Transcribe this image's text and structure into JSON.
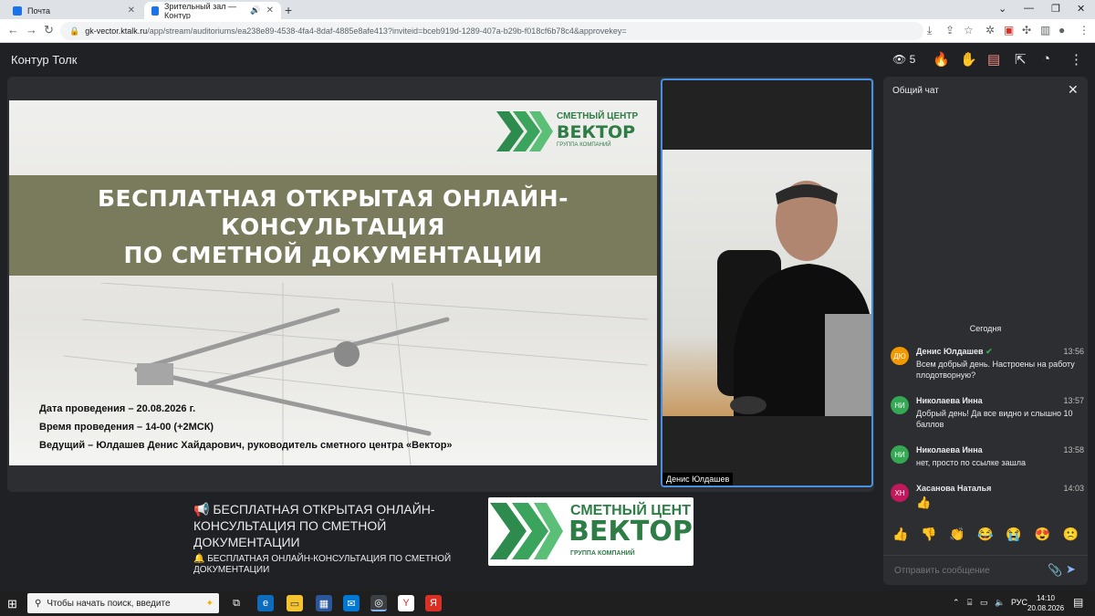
{
  "browser": {
    "tabs": [
      {
        "title": "Почта",
        "favicon_color": "#1a73e8"
      },
      {
        "title": "Зрительный зал — Контур",
        "favicon_color": "#1a73e8"
      }
    ],
    "url_host": "gk-vector.ktalk.ru",
    "url_path": "/app/stream/auditoriums/ea238e89-4538-4fa4-8daf-4885e8afe413?inviteid=bceb919d-1289-407a-b29b-f018cf6b78c4&approvekey="
  },
  "app": {
    "name": "Контур Толк",
    "viewers_count": "5"
  },
  "slide": {
    "title_lines": [
      "БЕСПЛАТНАЯ ОТКРЫТАЯ ОНЛАЙН-",
      "КОНСУЛЬТАЦИЯ",
      "ПО СМЕТНОЙ ДОКУМЕНТАЦИИ"
    ],
    "logo_line1": "СМЕТНЫЙ ЦЕНТР",
    "logo_line2": "ВЕКТОР",
    "logo_line3": "ГРУППА КОМПАНИЙ",
    "date_line": "Дата проведения – 20.08.2026 г.",
    "time_line": "Время проведения – 14-00 (+2МСК)",
    "host_line": "Ведущий – Юлдашев Денис Хайдарович, руководитель сметного центра «Вектор»"
  },
  "camera": {
    "participant_name": "Денис Юлдашев"
  },
  "announcement": {
    "title": "БЕСПЛАТНАЯ ОТКРЫТАЯ ОНЛАЙН-КОНСУЛЬТАЦИЯ ПО СМЕТНОЙ ДОКУМЕНТАЦИИ",
    "subtitle": "БЕСПЛАТНАЯ ОНЛАЙН-КОНСУЛЬТАЦИЯ ПО СМЕТНОЙ ДОКУМЕНТАЦИИ",
    "logo_line1": "СМЕТНЫЙ ЦЕНТ",
    "logo_line2": "ВЕКТОР",
    "logo_line3": "ГРУППА КОМПАНИЙ"
  },
  "chat": {
    "title": "Общий чат",
    "date_divider": "Сегодня",
    "messages": [
      {
        "initials": "ДЮ",
        "author": "Денис Юлдашев",
        "time": "13:56",
        "text": "Всем добрый день. Настроены на работу плодотворную?",
        "avatar_color": "#f29900"
      },
      {
        "initials": "НИ",
        "author": "Николаева Инна",
        "time": "13:57",
        "text": "Добрый день! Да все видно и слышно 10 баллов",
        "avatar_color": "#34a853"
      },
      {
        "initials": "НИ",
        "author": "Николаева Инна",
        "time": "13:58",
        "text": "нет, просто по ссылке зашла",
        "avatar_color": "#34a853"
      },
      {
        "initials": "ХН",
        "author": "Хасанова Наталья",
        "time": "14:03",
        "text": "👍",
        "avatar_color": "#c2185b"
      }
    ],
    "reactions": [
      "👍",
      "👎",
      "👏",
      "😂",
      "😭",
      "😍",
      "🙁"
    ],
    "input_placeholder": "Отправить сообщение"
  },
  "taskbar": {
    "search_placeholder": "Чтобы начать поиск, введите",
    "language": "РУС",
    "time": "14:10",
    "date": "20.08.2026"
  }
}
